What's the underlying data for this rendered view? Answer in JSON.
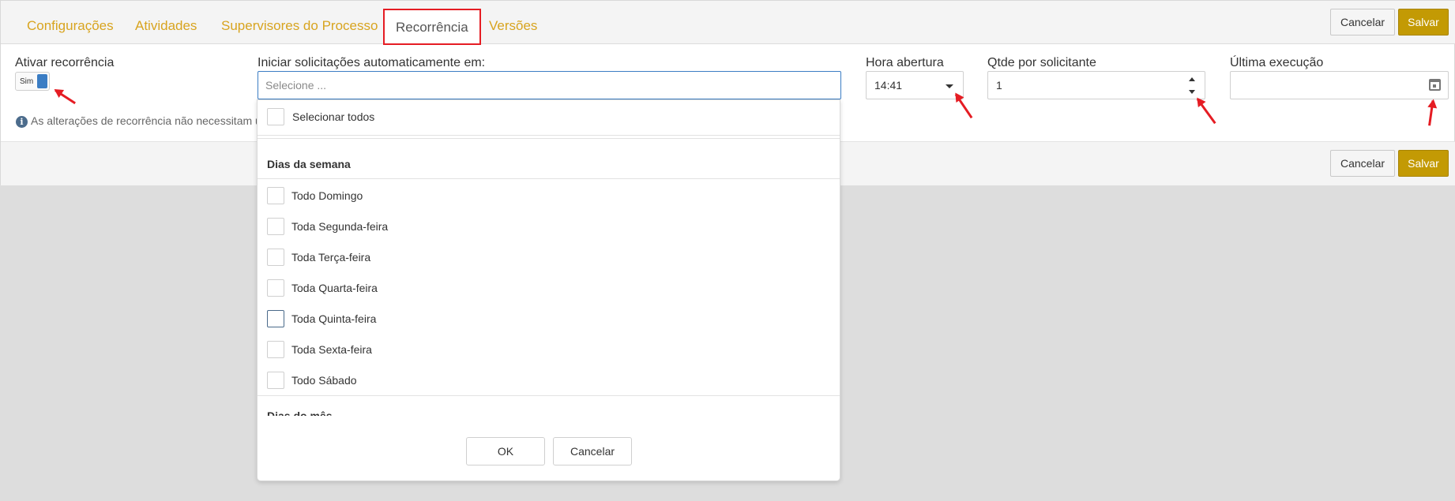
{
  "tabs": [
    {
      "label": "Configurações"
    },
    {
      "label": "Atividades"
    },
    {
      "label": "Supervisores do Processo"
    },
    {
      "label": "Recorrência",
      "active": true
    },
    {
      "label": "Versões"
    }
  ],
  "header": {
    "cancel_label": "Cancelar",
    "save_label": "Salvar"
  },
  "form": {
    "ativar_recorrencia": {
      "label": "Ativar recorrência",
      "toggle_text": "Sim"
    },
    "iniciar": {
      "label": "Iniciar solicitações automaticamente em:",
      "placeholder": "Selecione ..."
    },
    "hora_abertura": {
      "label": "Hora abertura",
      "value": "14:41"
    },
    "qtde": {
      "label": "Qtde por solicitante",
      "value": "1"
    },
    "ultima_execucao": {
      "label": "Última execução",
      "value": ""
    },
    "info_text": "As alterações de recorrência não necessitam ur"
  },
  "footer": {
    "cancel_label": "Cancelar",
    "save_label": "Salvar"
  },
  "dropdown": {
    "select_all": "Selecionar todos",
    "group_week": "Dias da semana",
    "days": [
      "Todo Domingo",
      "Toda Segunda-feira",
      "Toda Terça-feira",
      "Toda Quarta-feira",
      "Toda Quinta-feira",
      "Toda Sexta-feira",
      "Todo Sábado"
    ],
    "group_month": "Dias do mês",
    "ok_label": "OK",
    "cancel_label": "Cancelar"
  },
  "colors": {
    "accent": "#d8a41f",
    "primary": "#c39a04",
    "focus": "#3b7dc4",
    "annotation": "#e51c23"
  }
}
